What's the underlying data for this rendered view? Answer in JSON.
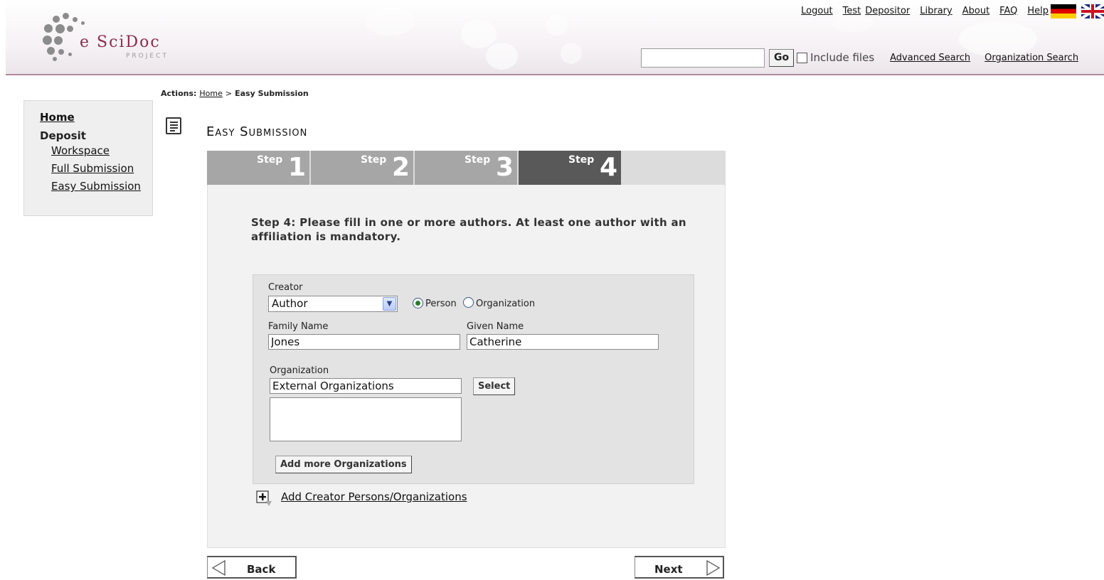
{
  "header": {
    "logo_text": "e SciDoc",
    "logo_sub": "PROJECT",
    "top_links": {
      "logout": "Logout",
      "user_first": "Test",
      "user_last": "Depositor",
      "library": "Library",
      "about": "About",
      "faq": "FAQ",
      "help": "Help"
    },
    "search": {
      "value": "",
      "go_label": "Go",
      "include_files_label": "Include files",
      "include_files_checked": false,
      "advanced_search": "Advanced Search",
      "organization_search": "Organization Search"
    },
    "colors": {
      "brand": "#8b2d4d",
      "header_border": "#b28aa0"
    }
  },
  "breadcrumb": {
    "prefix": "Actions:",
    "home": "Home",
    "separator": ">",
    "current": "Easy Submission"
  },
  "leftnav": {
    "home": "Home",
    "section": "Deposit",
    "items": [
      {
        "label": "Workspace"
      },
      {
        "label": "Full Submission"
      },
      {
        "label": "Easy Submission"
      }
    ]
  },
  "page": {
    "title": "Easy Submission",
    "icon": "document-icon"
  },
  "steps": [
    {
      "word": "Step",
      "number": "1",
      "active": false
    },
    {
      "word": "Step",
      "number": "2",
      "active": false
    },
    {
      "word": "Step",
      "number": "3",
      "active": false
    },
    {
      "word": "Step",
      "number": "4",
      "active": true
    }
  ],
  "form": {
    "instructions": "Step 4: Please fill in one or more authors. At least one author with an affiliation is mandatory.",
    "creator_label": "Creator",
    "creator_role": "Author",
    "creator_type": {
      "person_label": "Person",
      "organization_label": "Organization",
      "selected": "Person"
    },
    "family_name_label": "Family Name",
    "family_name_value": "Jones",
    "given_name_label": "Given Name",
    "given_name_value": "Catherine",
    "organization_label": "Organization",
    "organization_value": "External Organizations",
    "select_button": "Select",
    "organization_details": "",
    "add_orgs_button": "Add more Organizations",
    "add_creator_link": "Add Creator Persons/Organizations"
  },
  "navigation": {
    "back": "Back",
    "next": "Next"
  }
}
